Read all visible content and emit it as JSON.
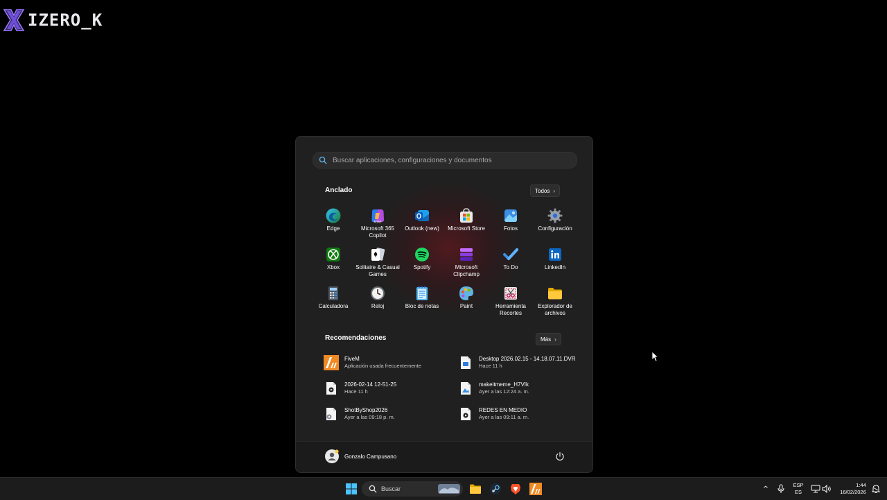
{
  "watermark": {
    "text": "IZERO_K"
  },
  "start_menu": {
    "search": {
      "placeholder": "Buscar aplicaciones, configuraciones y documentos"
    },
    "pinned": {
      "title": "Anclado",
      "all_button": "Todos",
      "apps": [
        {
          "label": "Edge",
          "icon": "edge-icon"
        },
        {
          "label": "Microsoft 365 Copilot",
          "icon": "m365-copilot-icon"
        },
        {
          "label": "Outlook (new)",
          "icon": "outlook-icon"
        },
        {
          "label": "Microsoft Store",
          "icon": "store-icon"
        },
        {
          "label": "Fotos",
          "icon": "photos-icon"
        },
        {
          "label": "Configuración",
          "icon": "gear-icon"
        },
        {
          "label": "Xbox",
          "icon": "xbox-icon"
        },
        {
          "label": "Solitaire & Casual Games",
          "icon": "solitaire-icon"
        },
        {
          "label": "Spotify",
          "icon": "spotify-icon"
        },
        {
          "label": "Microsoft Clipchamp",
          "icon": "clipchamp-icon"
        },
        {
          "label": "To Do",
          "icon": "todo-icon"
        },
        {
          "label": "LinkedIn",
          "icon": "linkedin-icon"
        },
        {
          "label": "Calculadora",
          "icon": "calculator-icon"
        },
        {
          "label": "Reloj",
          "icon": "clock-icon"
        },
        {
          "label": "Bloc de notas",
          "icon": "notepad-icon"
        },
        {
          "label": "Paint",
          "icon": "paint-icon"
        },
        {
          "label": "Herramienta Recortes",
          "icon": "snipping-tool-icon"
        },
        {
          "label": "Explorador de archivos",
          "icon": "folder-icon"
        }
      ]
    },
    "recommended": {
      "title": "Recomendaciones",
      "more_button": "Más",
      "items": [
        {
          "title": "FiveM",
          "subtitle": "Aplicación usada frecuentemente",
          "icon": "fivem-icon"
        },
        {
          "title": "Desktop 2026.02.15 - 14.18.07.11.DVR",
          "subtitle": "Hace 11 h",
          "icon": "video-file-icon"
        },
        {
          "title": "2026-02-14 12-51-25",
          "subtitle": "Hace 11 h",
          "icon": "media-file-icon"
        },
        {
          "title": "makeitmeme_H7VIk",
          "subtitle": "Ayer a las 12:24 a. m.",
          "icon": "image-file-icon"
        },
        {
          "title": "ShotByShop2026",
          "subtitle": "Ayer a las 09:18 p. m.",
          "icon": "settings-file-icon"
        },
        {
          "title": "REDES EN MEDIO",
          "subtitle": "Ayer a las 09:11 a. m.",
          "icon": "media-file-icon"
        }
      ]
    },
    "user": {
      "name": "Gonzalo Campusano"
    }
  },
  "taskbar": {
    "search_label": "Buscar",
    "language": {
      "line1": "ESP",
      "line2": "ES"
    },
    "clock": {
      "time": "1:44",
      "date": "16/02/2026"
    }
  },
  "colors": {
    "start_bg": "#202020",
    "taskbar_bg": "#1c1c1c",
    "accent": "#0078d4"
  }
}
